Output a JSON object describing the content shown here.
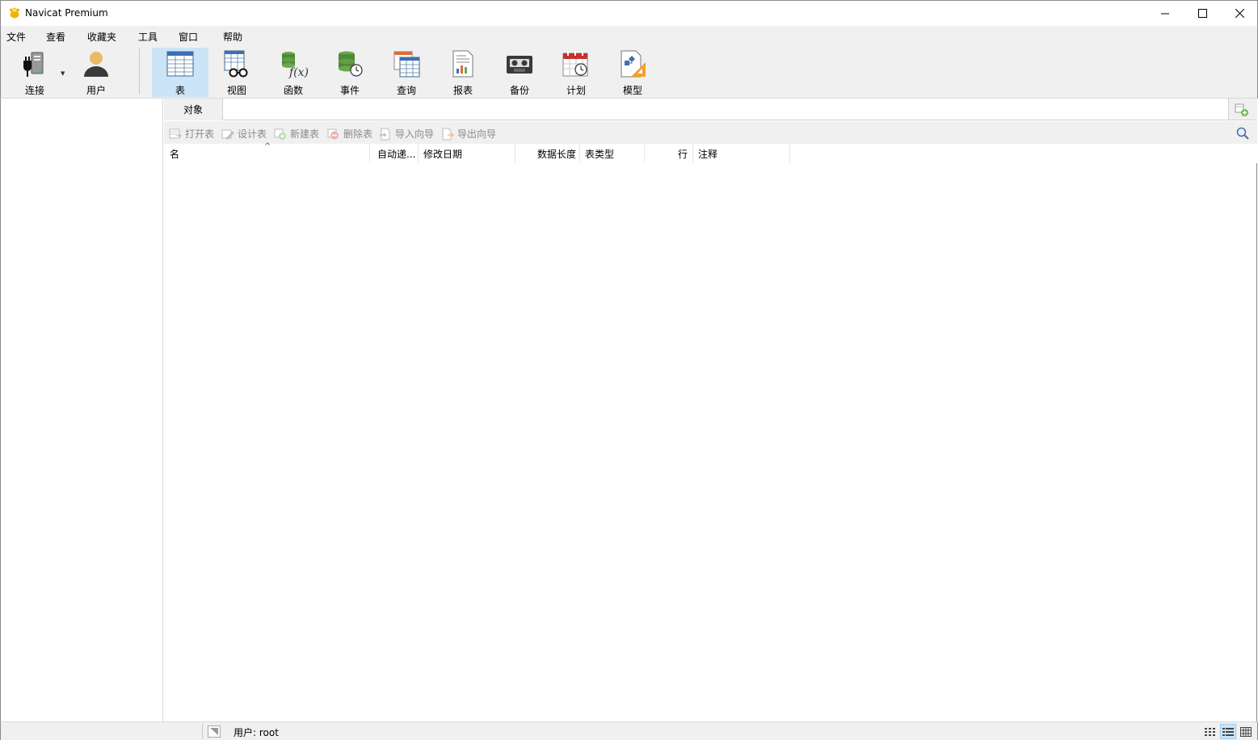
{
  "window": {
    "title": "Navicat Premium",
    "icon": "navicat-logo-icon"
  },
  "menu": [
    "文件",
    "查看",
    "收藏夹",
    "工具",
    "窗口",
    "帮助"
  ],
  "toolbar": {
    "connect": "连接",
    "user": "用户",
    "items": [
      "表",
      "视图",
      "函数",
      "事件",
      "查询",
      "报表",
      "备份",
      "计划",
      "模型"
    ],
    "active": "表"
  },
  "object_tab": {
    "label": "对象"
  },
  "object_toolbar": [
    "打开表",
    "设计表",
    "新建表",
    "删除表",
    "导入向导",
    "导出向导"
  ],
  "grid": {
    "columns": [
      "名",
      "自动递...",
      "修改日期",
      "数据长度",
      "表类型",
      "行",
      "注释"
    ],
    "rows": []
  },
  "status": {
    "user_text": "用户: root"
  },
  "colors": {
    "accent": "#cce4f7",
    "chrome": "#f0f0f0",
    "disabled_text": "#8a8a8a"
  }
}
